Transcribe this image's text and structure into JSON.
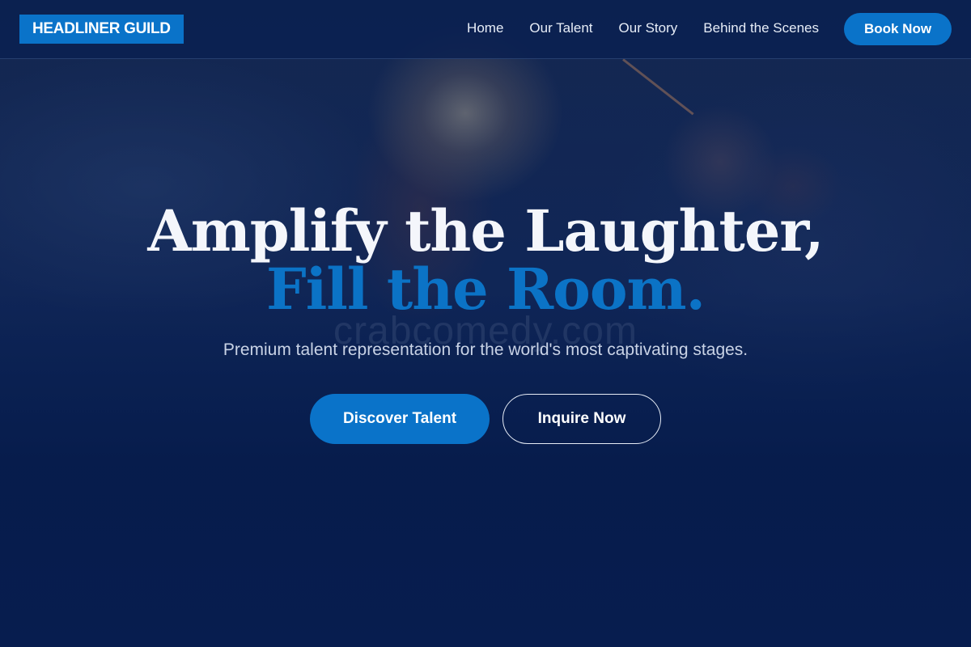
{
  "brand": {
    "logo_text": "HEADLINER GUILD",
    "accent_color": "#0a73c9",
    "background_color": "#0b2250"
  },
  "nav": {
    "items": [
      {
        "label": "Home"
      },
      {
        "label": "Our Talent"
      },
      {
        "label": "Our Story"
      },
      {
        "label": "Behind the Scenes"
      }
    ],
    "cta_label": "Book Now"
  },
  "hero": {
    "title_line1": "Amplify the Laughter,",
    "title_line2": "Fill the Room.",
    "watermark": "crabcomedy.com",
    "subtitle": "Premium talent representation for the world's most captivating stages.",
    "primary_button": "Discover Talent",
    "secondary_button": "Inquire Now"
  }
}
